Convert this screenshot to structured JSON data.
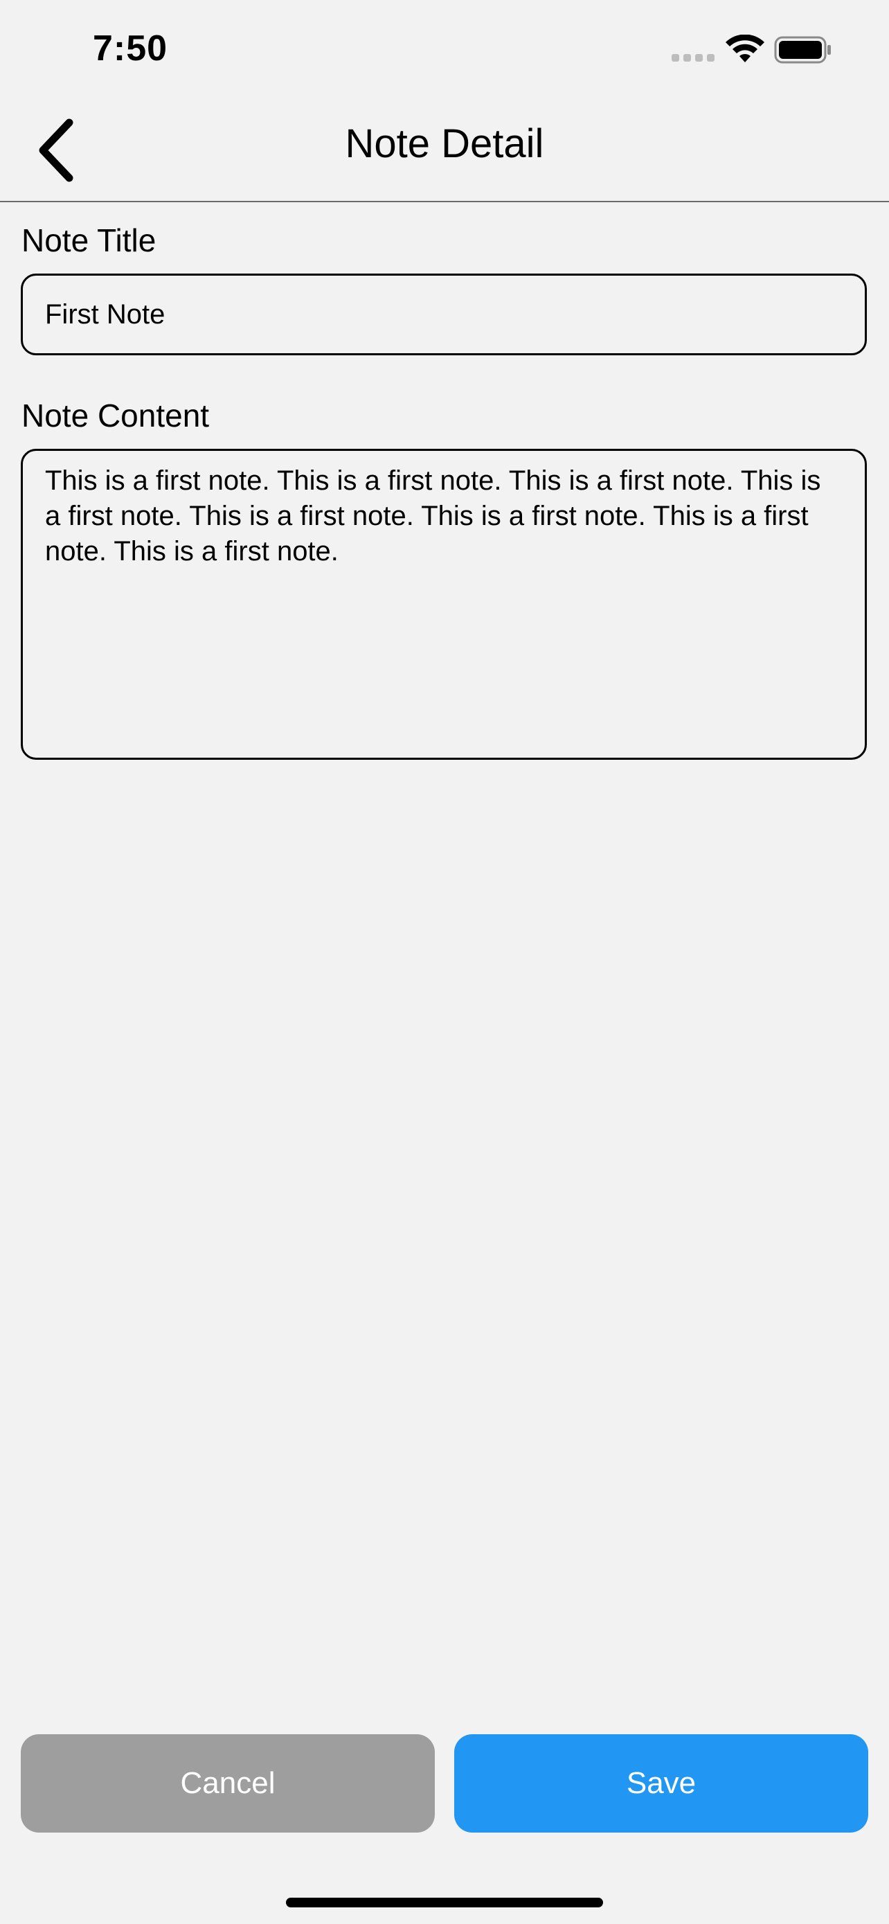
{
  "status_bar": {
    "time": "7:50"
  },
  "nav": {
    "title": "Note Detail"
  },
  "form": {
    "title_label": "Note Title",
    "title_value": "First Note",
    "content_label": "Note Content",
    "content_value": "This is a first note. This is a first note. This is a first note. This is a first note. This is a first note. This is a first note. This is a first note. This is a first note."
  },
  "actions": {
    "cancel_label": "Cancel",
    "save_label": "Save"
  },
  "colors": {
    "background": "#f2f2f2",
    "cancel_button": "#9e9e9e",
    "save_button": "#2196f3"
  },
  "icons": {
    "back": "chevron-left-icon",
    "signal": "cellular-signal-icon",
    "wifi": "wifi-icon",
    "battery": "battery-icon"
  }
}
